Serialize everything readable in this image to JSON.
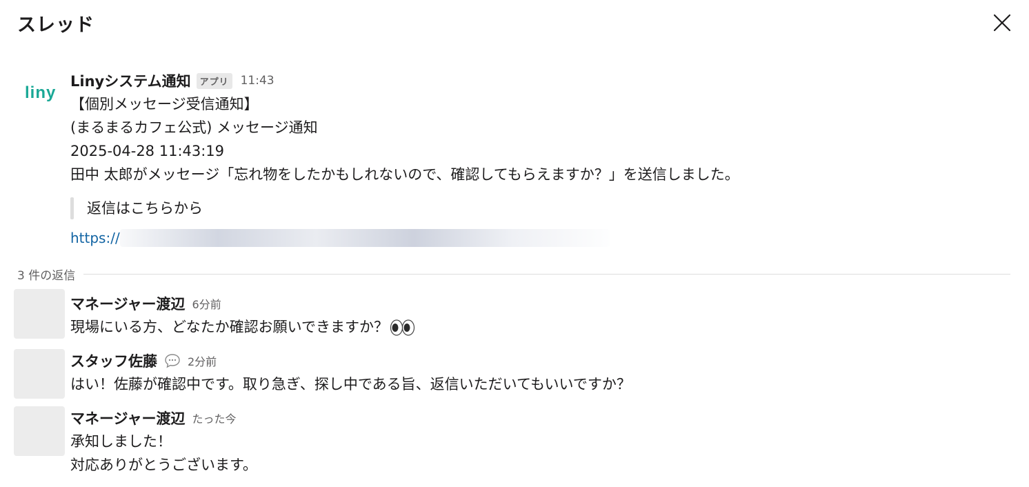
{
  "header": {
    "title": "スレッド",
    "close_icon": "close-icon"
  },
  "parent_message": {
    "avatar_icon": "liny-logo",
    "avatar_text": "Liny",
    "avatar_color": "#1aa896",
    "sender": "Linyシステム通知",
    "badge": "アプリ",
    "time": "11:43",
    "lines": [
      "【個別メッセージ受信通知】",
      "(まるまるカフェ公式) メッセージ通知",
      "2025-04-28 11:43:19",
      "田中 太郎がメッセージ「忘れ物をしたかもしれないので、確認してもらえますか？」を送信しました。"
    ],
    "quote": "返信はこちらから",
    "link_prefix": "https://"
  },
  "replies_divider": {
    "label": "3 件の返信"
  },
  "replies": [
    {
      "sender": "マネージャー渡辺",
      "time": "6分前",
      "text": "現場にいる方、どなたか確認お願いできますか？",
      "emoji": "eyes-emoji"
    },
    {
      "sender": "スタッフ佐藤",
      "status_icon": "speech-bubble-icon",
      "time": "2分前",
      "text": "はい！佐藤が確認中です。取り急ぎ、探し中である旨、返信いただいてもいいですか？"
    },
    {
      "sender": "マネージャー渡辺",
      "time": "たった今",
      "lines": [
        "承知しました！",
        "対応ありがとうございます。"
      ]
    }
  ],
  "colors": {
    "text": "#1d1c1d",
    "muted": "#616061",
    "link": "#1264a3",
    "brand": "#1aa896"
  }
}
